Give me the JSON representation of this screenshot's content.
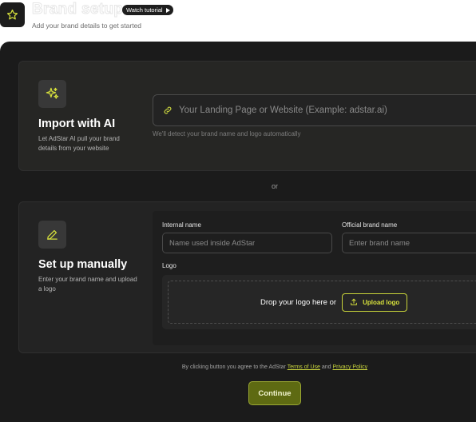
{
  "header": {
    "title": "Brand setup",
    "tutorial_label": "Watch tutorial",
    "subtitle": "Add your brand details to get started"
  },
  "import_ai": {
    "title": "Import with AI",
    "description": "Let AdStar AI pull your brand details from your website",
    "url_placeholder": "Your Landing Page or Website (Example: adstar.ai)",
    "helper": "We'll detect your brand name and logo automatically"
  },
  "divider_text": "or",
  "manual": {
    "title": "Set up manually",
    "description": "Enter your brand name and upload a logo",
    "internal_name_label": "Internal name",
    "internal_name_placeholder": "Name used inside AdStar",
    "official_name_label": "Official brand name",
    "official_name_placeholder": "Enter brand name",
    "logo_label": "Logo",
    "drop_text": "Drop your logo here or",
    "upload_label": "Upload logo"
  },
  "footer": {
    "consent_prefix": "By clicking button you agree to the AdStar",
    "terms_label": "Terms of Use",
    "consent_and": "and",
    "privacy_label": "Privacy Policy",
    "continue_label": "Continue"
  },
  "colors": {
    "accent": "#d6e03c",
    "panel_bg": "#1b1b1b",
    "card_bg": "#232323",
    "continue_bg": "#5e6a12"
  },
  "icons": [
    "star-icon",
    "play-icon",
    "sparkles-icon",
    "link-icon",
    "pencil-icon",
    "upload-icon"
  ]
}
